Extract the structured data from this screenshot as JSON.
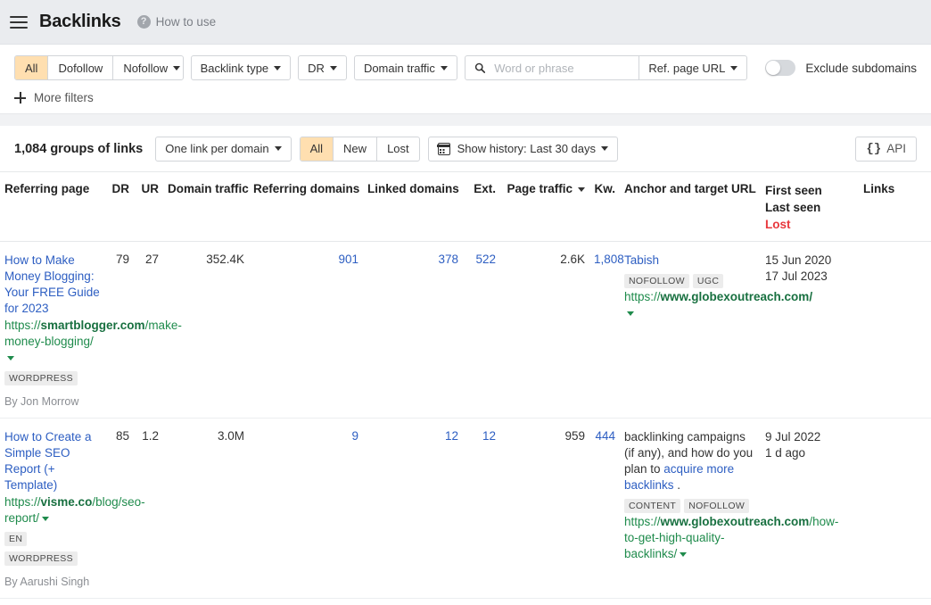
{
  "header": {
    "menu_icon": "hamburger-icon",
    "title": "Backlinks",
    "help_icon": "question-circle-icon",
    "help_label": "How to use"
  },
  "filters": {
    "follow_segments": [
      {
        "label": "All",
        "active": true
      },
      {
        "label": "Dofollow",
        "active": false
      },
      {
        "label": "Nofollow",
        "active": false,
        "caret": true
      }
    ],
    "backlink_type": "Backlink type",
    "dr": "DR",
    "domain_traffic": "Domain traffic",
    "search_icon": "search-icon",
    "search_value": "",
    "search_placeholder": "Word or phrase",
    "ref_page_url": "Ref. page URL",
    "exclude_toggle_on": false,
    "exclude_label": "Exclude subdomains",
    "more_filters": "More filters",
    "plus_icon": "plus-icon"
  },
  "toolbar": {
    "count": "1,084 groups of links",
    "grouping": "One link per domain",
    "state_segments": [
      {
        "label": "All",
        "active": true
      },
      {
        "label": "New",
        "active": false
      },
      {
        "label": "Lost",
        "active": false
      }
    ],
    "history_icon": "calendar-icon",
    "history": "Show history: Last 30 days",
    "api_icon": "code-braces-icon",
    "api_label": "API"
  },
  "table": {
    "columns": {
      "referring_page": "Referring page",
      "dr": "DR",
      "ur": "UR",
      "domain_traffic": "Domain traffic",
      "referring_domains": "Referring domains",
      "linked_domains": "Linked domains",
      "ext": "Ext.",
      "page_traffic": "Page traffic",
      "kw": "Kw.",
      "anchor_and_target_url": "Anchor and target URL",
      "first_seen": "First seen",
      "last_seen": "Last seen",
      "lost": "Lost",
      "links": "Links"
    },
    "rows": [
      {
        "title": "How to Make Money Blogging: Your FREE Guide for 2023",
        "url_proto": "https://",
        "url_domain": "smartblogger.com",
        "url_path": "/make-money-blogging/",
        "badges": [
          "WORDPRESS"
        ],
        "byline": "By Jon Morrow",
        "dr": "79",
        "ur": "27",
        "domain_traffic": "352.4K",
        "referring_domains": "901",
        "linked_domains": "378",
        "ext": "522",
        "page_traffic": "2.6K",
        "kw": "1,808",
        "anchor_text": "Tabish",
        "anchor_badges": [
          "NOFOLLOW",
          "UGC"
        ],
        "target_proto": "https://",
        "target_domain": "www.globexoutreach.com",
        "target_path": "/",
        "first_seen": "15 Jun 2020",
        "last_seen": "17 Jul 2023"
      },
      {
        "title": "How to Create a Simple SEO Report (+ Template)",
        "url_proto": "https://",
        "url_domain": "visme.co",
        "url_path": "/blog/seo-report/",
        "badges": [
          "EN",
          "WORDPRESS"
        ],
        "byline": "By Aarushi Singh",
        "dr": "85",
        "ur": "1.2",
        "domain_traffic": "3.0M",
        "referring_domains": "9",
        "linked_domains": "12",
        "ext": "12",
        "page_traffic": "959",
        "kw": "444",
        "anchor_prefix": "backlinking campaigns (if any), and how do you plan to ",
        "anchor_link1": "acquire more backlinks",
        "anchor_suffix": " .",
        "anchor_badges": [
          "CONTENT",
          "NOFOLLOW"
        ],
        "target_proto": "https://",
        "target_domain": "www.globexoutreach.com",
        "target_path": "/how-to-get-high-quality-backlinks/",
        "first_seen": "9 Jul 2022",
        "last_seen": "1 d ago"
      }
    ]
  }
}
